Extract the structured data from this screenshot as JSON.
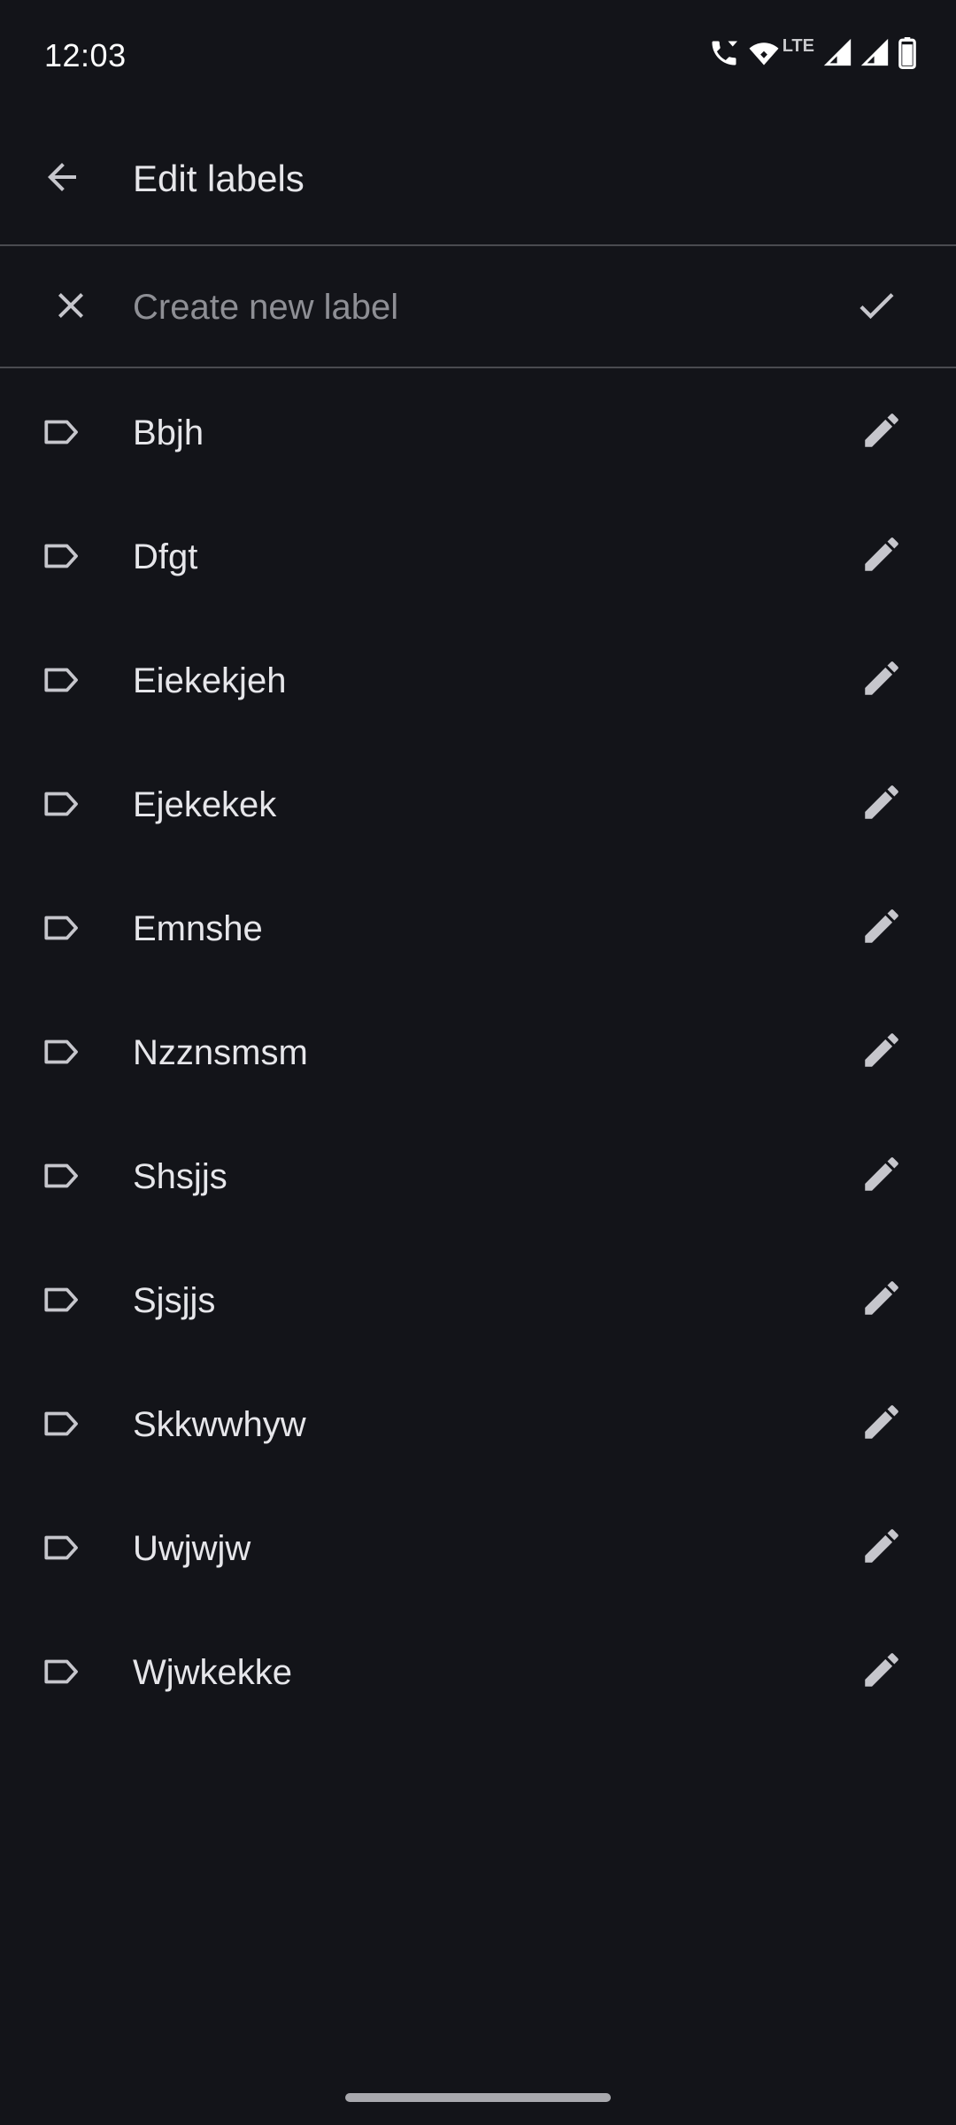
{
  "status_bar": {
    "time": "12:03",
    "network_label": "LTE",
    "icons": [
      "wifi-calling-icon",
      "wifi-icon",
      "signal-icon",
      "signal-icon",
      "battery-icon"
    ]
  },
  "app_bar": {
    "title": "Edit labels",
    "back_icon": "arrow-back-icon"
  },
  "create_label": {
    "placeholder": "Create new label",
    "value": "",
    "close_icon": "close-icon",
    "confirm_icon": "check-icon"
  },
  "labels": [
    {
      "name": "Bbjh"
    },
    {
      "name": "Dfgt"
    },
    {
      "name": "Eiekekjeh"
    },
    {
      "name": "Ejekekek"
    },
    {
      "name": "Emnshe"
    },
    {
      "name": "Nzznsmsm"
    },
    {
      "name": "Shsjjs"
    },
    {
      "name": "Sjsjjs"
    },
    {
      "name": "Skkwwhyw"
    },
    {
      "name": "Uwjwjw"
    },
    {
      "name": "Wjwkekke"
    }
  ],
  "colors": {
    "background": "#131419",
    "text": "#e6e6ea",
    "placeholder": "#8e8f95",
    "icon": "#c6c6cc",
    "divider": "#4a4b50"
  }
}
